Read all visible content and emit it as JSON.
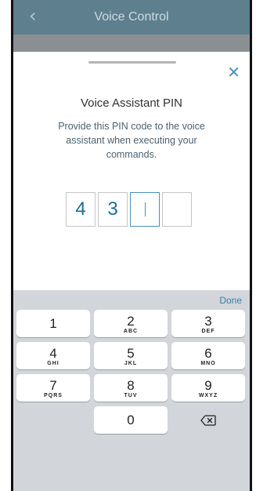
{
  "navbar": {
    "title": "Voice Control",
    "back_icon": "chevron-left-icon"
  },
  "sheet": {
    "close_icon": "close-icon",
    "title": "Voice Assistant PIN",
    "description": "Provide this PIN code to the voice assistant when executing your commands.",
    "pin_digits": [
      "4",
      "3",
      "",
      ""
    ]
  },
  "keyboard": {
    "done_label": "Done",
    "keys": [
      {
        "number": "1",
        "letters": ""
      },
      {
        "number": "2",
        "letters": "ABC"
      },
      {
        "number": "3",
        "letters": "DEF"
      },
      {
        "number": "4",
        "letters": "GHI"
      },
      {
        "number": "5",
        "letters": "JKL"
      },
      {
        "number": "6",
        "letters": "MNO"
      },
      {
        "number": "7",
        "letters": "PQRS"
      },
      {
        "number": "8",
        "letters": "TUV"
      },
      {
        "number": "9",
        "letters": "WXYZ"
      },
      {
        "number": "0",
        "letters": ""
      }
    ],
    "delete_icon": "backspace-icon"
  },
  "colors": {
    "navbar": "#5d7f8e",
    "accent": "#4a90b8",
    "keyboard": "#d2d5d9"
  }
}
